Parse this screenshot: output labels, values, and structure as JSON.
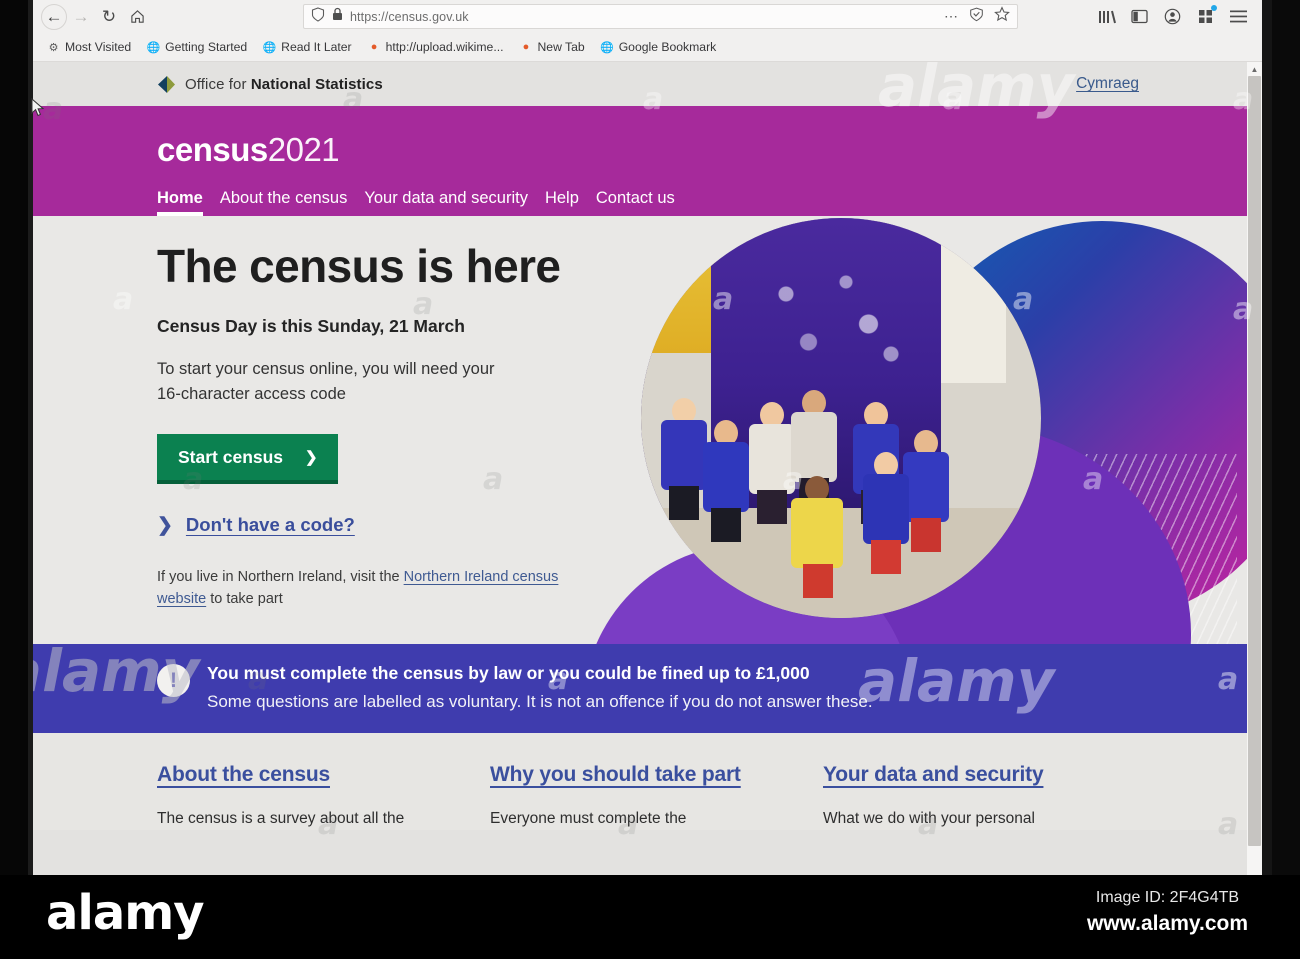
{
  "browser": {
    "back_icon": "back-arrow-icon",
    "forward_icon": "forward-arrow-icon",
    "reload_icon": "reload-icon",
    "home_icon": "home-icon",
    "url": "https://census.gov.uk",
    "shield_icon": "shield-icon",
    "lock_icon": "padlock-icon",
    "page_actions_icon": "ellipsis-icon",
    "reader_shield_icon": "pocket-icon",
    "bookmark_star_icon": "star-icon",
    "library_icon": "library-icon",
    "sidebar_icon": "sidebar-icon",
    "account_icon": "account-icon",
    "extension_icon": "extensions-icon",
    "menu_icon": "hamburger-menu-icon",
    "bookmarks": [
      {
        "label": "Most Visited",
        "icon": "gear-icon"
      },
      {
        "label": "Getting Started",
        "icon": "globe-icon"
      },
      {
        "label": "Read It Later",
        "icon": "globe-icon"
      },
      {
        "label": "http://upload.wikime...",
        "icon": "firefox-icon"
      },
      {
        "label": "New Tab",
        "icon": "firefox-icon"
      },
      {
        "label": "Google Bookmark",
        "icon": "globe-icon"
      }
    ]
  },
  "ons": {
    "logo_text_1": "Office for ",
    "logo_text_2": "National Statistics",
    "language_link": "Cymraeg"
  },
  "header": {
    "logo_word": "census",
    "logo_year": "2021",
    "nav": [
      {
        "label": "Home",
        "active": true
      },
      {
        "label": "About the census",
        "active": false
      },
      {
        "label": "Your data and security",
        "active": false
      },
      {
        "label": "Help",
        "active": false
      },
      {
        "label": "Contact us",
        "active": false
      }
    ]
  },
  "hero": {
    "heading": "The census is here",
    "subheading": "Census Day is this Sunday, 21 March",
    "body_line1": "To start your census online, you will need your",
    "body_line2": "16-character access code",
    "start_button": "Start census",
    "start_button_chevron": "chevron-right-icon",
    "code_link": "Don't have a code?",
    "code_link_chevron": "chevron-right-icon",
    "ni_note_before": "If you live in Northern Ireland, visit the ",
    "ni_note_link": "Northern Ireland census website",
    "ni_note_after": " to take part",
    "image_alt": "children-in-classroom-photo"
  },
  "notice": {
    "icon": "exclamation-icon",
    "line1": "You must complete the census by law or you could be fined up to £1,000",
    "line2": "Some questions are labelled as voluntary. It is not an offence if you do not answer these."
  },
  "cards": [
    {
      "title": "About the census",
      "body": "The census is a survey about all the"
    },
    {
      "title": "Why you should take part",
      "body": "Everyone must complete the"
    },
    {
      "title": "Your data and security",
      "body": "What we do with your personal"
    }
  ],
  "watermark": {
    "footer_logo": "alamy",
    "image_id": "Image ID: 2F4G4TB",
    "url": "www.alamy.com",
    "tile": "a"
  },
  "colors": {
    "magenta": "#a62a9b",
    "purple_notice": "#3f3cae",
    "green_button": "#0b8150",
    "link_blue": "#3a4f9e"
  }
}
